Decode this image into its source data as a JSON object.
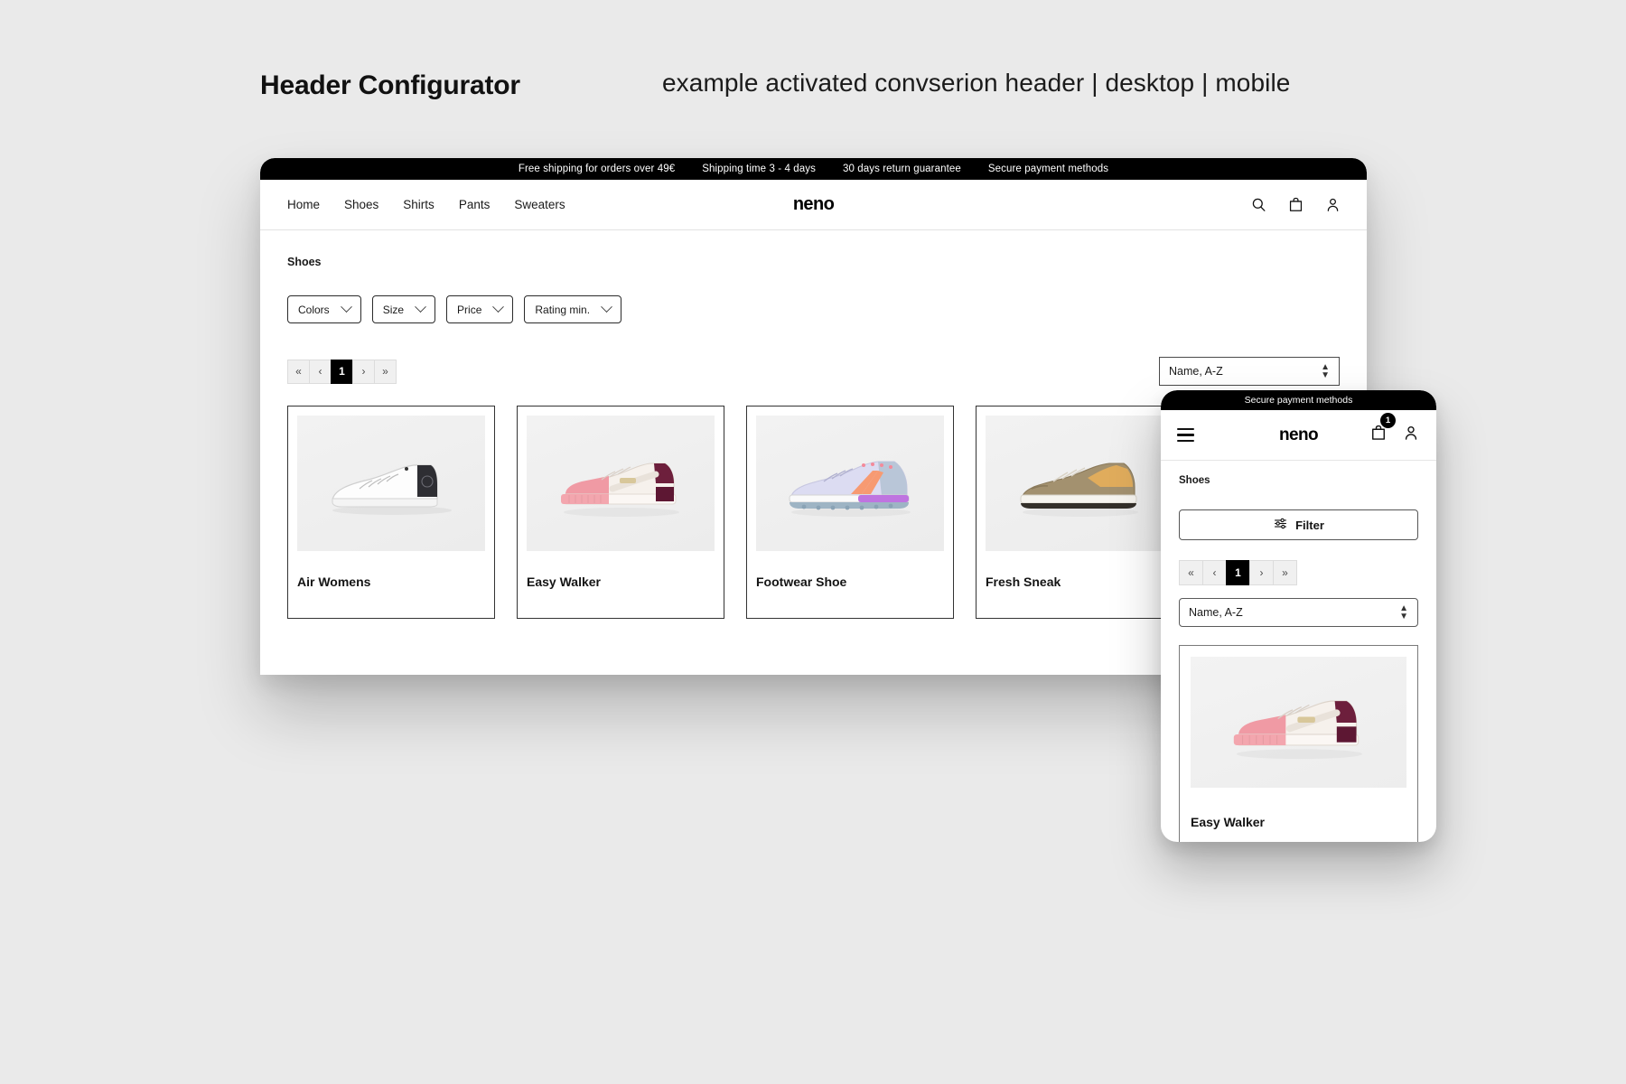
{
  "headings": {
    "title": "Header Configurator",
    "subtitle": "example activated convserion header | desktop | mobile"
  },
  "desktop": {
    "topbar": {
      "items": [
        "Free shipping for orders over 49€",
        "Shipping time 3 - 4 days",
        "30 days return guarantee",
        "Secure payment methods"
      ]
    },
    "nav": {
      "links": [
        "Home",
        "Shoes",
        "Shirts",
        "Pants",
        "Sweaters"
      ],
      "brand": "neno",
      "icons": [
        "search-icon",
        "bag-icon",
        "account-icon"
      ]
    },
    "breadcrumb": "Shoes",
    "filters": [
      {
        "label": "Colors"
      },
      {
        "label": "Size"
      },
      {
        "label": "Price"
      },
      {
        "label": "Rating min."
      }
    ],
    "pagination": {
      "first": "«",
      "prev": "‹",
      "current": "1",
      "next": "›",
      "last": "»"
    },
    "sort": {
      "value": "Name, A-Z"
    },
    "products": [
      {
        "name": "Air Womens",
        "image": "white-sneaker-black-heel"
      },
      {
        "name": "Easy Walker",
        "image": "pink-cream-platform-sneaker"
      },
      {
        "name": "Footwear Shoe",
        "image": "lilac-orange-running-shoe"
      },
      {
        "name": "Fresh Sneak",
        "image": "tan-suede-runner"
      }
    ]
  },
  "mobile": {
    "topbar": {
      "text": "Secure payment methods"
    },
    "nav": {
      "brand": "neno",
      "menu_icon": "hamburger-icon",
      "cart_badge": "1",
      "icons": [
        "bag-icon",
        "account-icon"
      ]
    },
    "breadcrumb": "Shoes",
    "filter_button": {
      "label": "Filter",
      "icon": "sliders-icon"
    },
    "pagination": {
      "first": "«",
      "prev": "‹",
      "current": "1",
      "next": "›",
      "last": "»"
    },
    "sort": {
      "value": "Name, A-Z"
    },
    "products": [
      {
        "name": "Easy Walker",
        "image": "pink-cream-platform-sneaker"
      }
    ]
  },
  "colors": {
    "background": "#eaeaea",
    "bar": "#000000",
    "surface": "#ffffff",
    "text": "#141414",
    "muted": "#4a4a4a",
    "pager_bg": "#f0f0f0"
  }
}
